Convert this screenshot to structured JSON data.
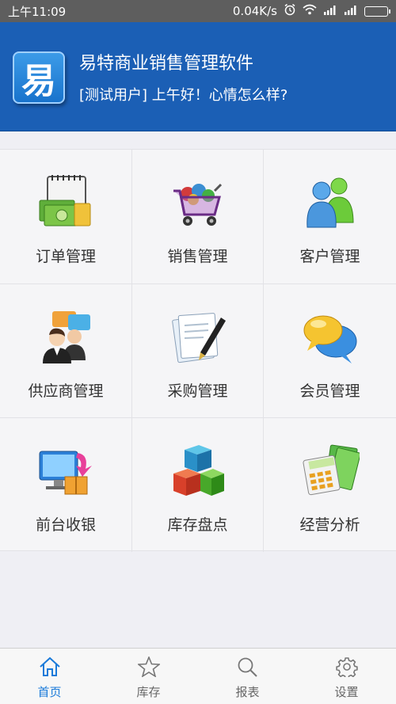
{
  "status_bar": {
    "time": "上午11:09",
    "network_speed": "0.04K/s"
  },
  "header": {
    "logo_char": "易",
    "title": "易特商业销售管理软件",
    "greeting": "[测试用户] 上午好！心情怎么样?"
  },
  "grid": {
    "items": [
      {
        "label": "订单管理",
        "icon": "order-icon"
      },
      {
        "label": "销售管理",
        "icon": "shopping-cart-icon"
      },
      {
        "label": "客户管理",
        "icon": "customers-icon"
      },
      {
        "label": "供应商管理",
        "icon": "supplier-icon"
      },
      {
        "label": "采购管理",
        "icon": "purchase-pen-icon"
      },
      {
        "label": "会员管理",
        "icon": "member-chat-icon"
      },
      {
        "label": "前台收银",
        "icon": "cashier-icon"
      },
      {
        "label": "库存盘点",
        "icon": "inventory-blocks-icon"
      },
      {
        "label": "经营分析",
        "icon": "analysis-calculator-icon"
      }
    ]
  },
  "tabbar": {
    "tabs": [
      {
        "label": "首页",
        "icon": "home-icon",
        "active": true
      },
      {
        "label": "库存",
        "icon": "star-icon",
        "active": false
      },
      {
        "label": "报表",
        "icon": "search-icon",
        "active": false
      },
      {
        "label": "设置",
        "icon": "gear-icon",
        "active": false
      }
    ],
    "active_color": "#1a7ad9",
    "inactive_color": "#666666"
  },
  "colors": {
    "header_bg": "#1b5fb5",
    "status_bar_bg": "#5e5e5e",
    "page_bg": "#efeff4"
  }
}
